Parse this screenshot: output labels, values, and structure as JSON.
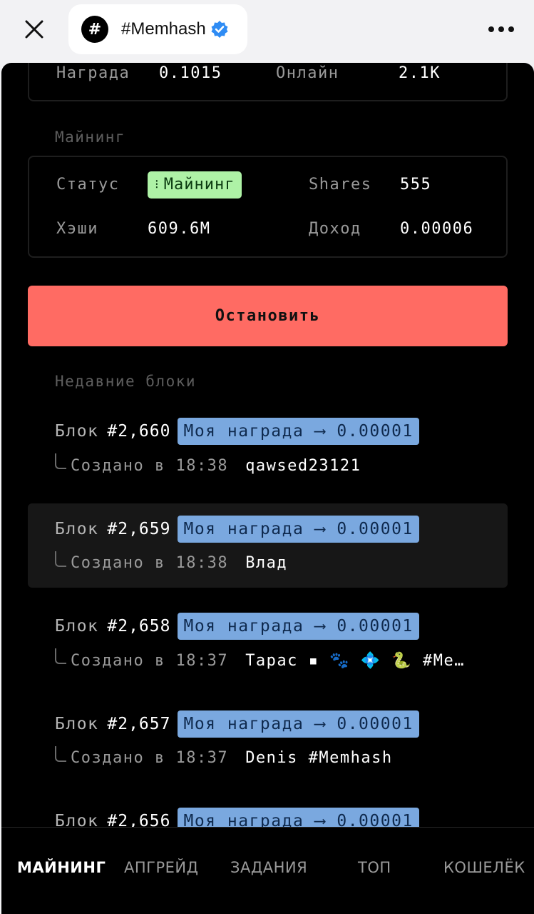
{
  "header": {
    "title": "#Memhash",
    "logo_glyph": "#",
    "icons": {
      "close": "close-icon",
      "verified": "verified-badge-icon",
      "more": "more-horizontal-icon"
    }
  },
  "stats": {
    "reward_label": "Награда",
    "reward_value": "0.1015",
    "online_label": "Онлайн",
    "online_value": "2.1K"
  },
  "mining": {
    "section_title": "Майнинг",
    "status_label": "Статус",
    "status_badge_dots": "⁝",
    "status_value": "Майнинг",
    "shares_label": "Shares",
    "shares_value": "555",
    "hashes_label": "Хэши",
    "hashes_value": "609.6M",
    "income_label": "Доход",
    "income_value": "0.00006",
    "stop_button": "Остановить"
  },
  "recent_blocks": {
    "section_title": "Недавние блоки",
    "items": [
      {
        "word": "Блок",
        "number": "#2,660",
        "reward": "Моя награда ⟶ 0.00001",
        "created": "Создано в 18:38",
        "author": "qawsed23121",
        "highlighted": false
      },
      {
        "word": "Блок",
        "number": "#2,659",
        "reward": "Моя награда ⟶ 0.00001",
        "created": "Создано в 18:38",
        "author": "Влад",
        "highlighted": true
      },
      {
        "word": "Блок",
        "number": "#2,658",
        "reward": "Моя награда ⟶ 0.00001",
        "created": "Создано в 18:37",
        "author": "Тарас ▪ 🐾 💠 🐍 #Me…",
        "highlighted": false
      },
      {
        "word": "Блок",
        "number": "#2,657",
        "reward": "Моя награда ⟶ 0.00001",
        "created": "Создано в 18:37",
        "author": "Denis #Memhash",
        "highlighted": false
      },
      {
        "word": "Блок",
        "number": "#2,656",
        "reward": "Моя награда ⟶ 0.00001",
        "created": "",
        "author": "",
        "highlighted": false
      }
    ]
  },
  "nav": {
    "mining": "МАЙНИНГ",
    "upgrade": "АПГРЕЙД",
    "tasks": "ЗАДАНИЯ",
    "top": "ТОП",
    "wallet": "КОШЕЛЁК"
  },
  "colors": {
    "status_badge_bg": "#aef2a6",
    "stop_button_bg": "#ff6b63",
    "reward_badge_bg": "#7aa8df"
  }
}
